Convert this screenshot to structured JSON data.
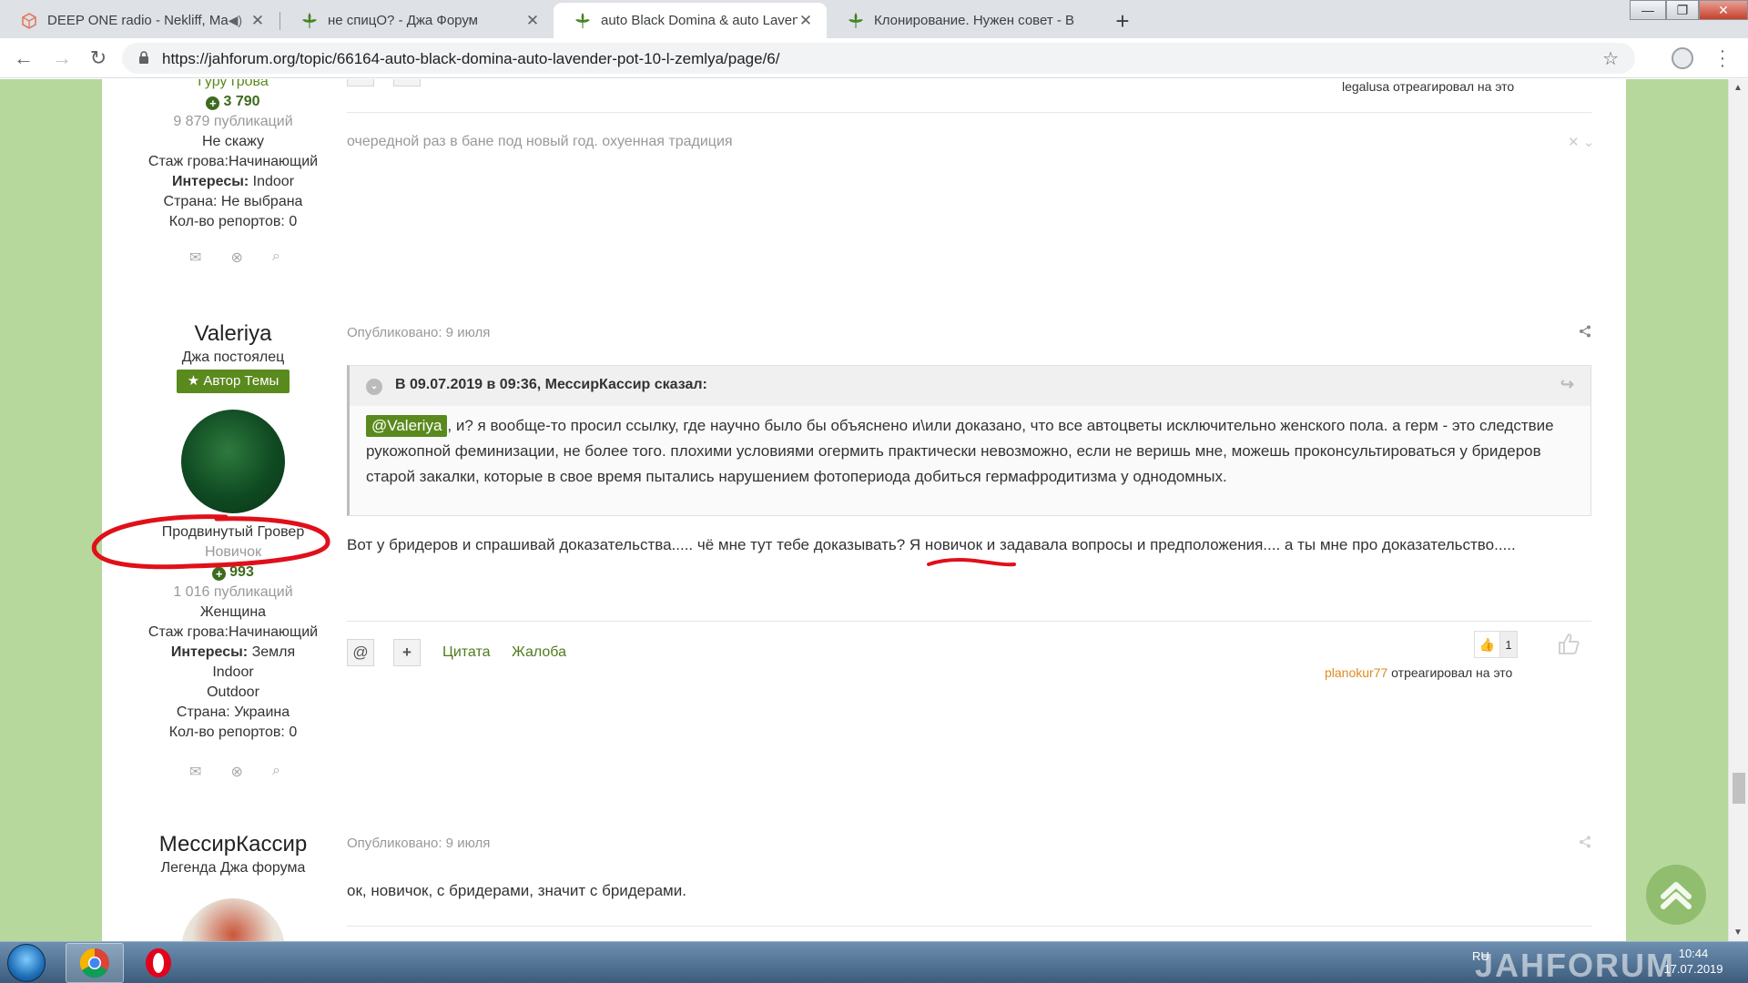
{
  "browser": {
    "tabs": [
      {
        "title": "DEEP ONE radio - Nekliff, Ma"
      },
      {
        "title": "не спицО? - Джа Форум"
      },
      {
        "title": "auto Black Domina & auto Laven"
      },
      {
        "title": "Клонирование. Нужен совет - B"
      }
    ],
    "url": "https://jahforum.org/topic/66164-auto-black-domina-auto-lavender-pot-10-l-zemlya/page/6/",
    "new_tab": "+",
    "win_min": "—",
    "win_max": "❐",
    "win_close": "✕"
  },
  "top_post": {
    "author_rank_partial": "Гуру грова",
    "rep": "3 790",
    "publications": "9 879 публикаций",
    "gender": "Не скажу",
    "experience": "Стаж грова:Начинающий",
    "interests_label": "Интересы:",
    "interests": "Indoor",
    "country": "Страна: Не выбрана",
    "reports": "Кол-во репортов: 0",
    "reacted_user": "legalusa",
    "reacted_suffix": "отреагировал на это",
    "hidden_text": "очередной раз в бане под новый год. охуенная традиция"
  },
  "post_valeriya": {
    "author": "Valeriya",
    "title": "Джа постоялец",
    "badge": "Автор Темы",
    "rank": "Продвинутый Гровер",
    "group": "Новичок",
    "rep": "993",
    "publications": "1 016 публикаций",
    "gender": "Женщина",
    "experience": "Стаж грова:Начинающий",
    "interests_label": "Интересы:",
    "interests": [
      "Земля",
      "Indoor",
      "Outdoor"
    ],
    "country": "Страна: Украина",
    "reports": "Кол-во репортов: 0",
    "date": "Опубликовано: 9 июля",
    "quote_header": "В 09.07.2019 в 09:36, МессирКассир сказал:",
    "quote_mention": "@Valeriya",
    "quote_text": ", и?  я вообще-то просил ссылку, где научно было бы объяснено и\\или доказано, что все автоцветы исключительно женского пола. а герм - это следствие рукожопной феминизации, не более того. плохими условиями огермить практически невозможно, если не веришь мне, можешь проконсультироваться у бридеров старой закалки, которые в свое время пытались нарушением фотопериода добиться гермафродитизма у однодомных.",
    "body": "Вот у бридеров и спрашивай доказательства..... чё мне тут тебе доказывать? Я новичок и задавала вопросы и предположения.... а ты мне про доказательство.....",
    "action_mention": "@",
    "action_plus": "+",
    "action_quote": "Цитата",
    "action_report": "Жалоба",
    "reaction_count": "1",
    "reacted_user": "planokur77",
    "reacted_suffix": "отреагировал на это"
  },
  "post_messir": {
    "author": "МессирКассир",
    "title": "Легенда Джа форума",
    "date": "Опубликовано: 9 июля",
    "body": "ок, новичок, с бридерами, значит с бридерами."
  },
  "taskbar": {
    "lang": "RU",
    "time": "10:44",
    "date": "17.07.2019"
  },
  "watermark": "JAHFORUM",
  "colors": {
    "page_bg": "#b7d89c",
    "accent_green": "#5a8a1e",
    "reaction_user": "#e08a1e",
    "annotation_red": "#e0101a"
  }
}
